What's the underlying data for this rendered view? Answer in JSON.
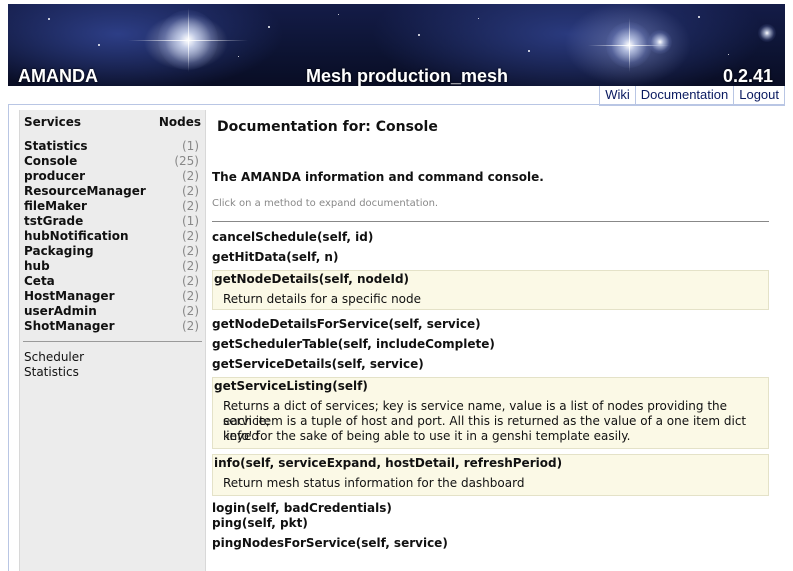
{
  "header": {
    "app_title": "AMANDA",
    "mesh_title": "Mesh production_mesh",
    "version": "0.2.41"
  },
  "nav": {
    "links": [
      "Wiki",
      "Documentation",
      "Logout"
    ]
  },
  "sidebar": {
    "col_services": "Services",
    "col_nodes": "Nodes",
    "services": [
      {
        "name": "Statistics",
        "count": "(1)"
      },
      {
        "name": "Console",
        "count": "(25)"
      },
      {
        "name": "producer",
        "count": "(2)"
      },
      {
        "name": "ResourceManager",
        "count": "(2)"
      },
      {
        "name": "fileMaker",
        "count": "(2)"
      },
      {
        "name": "tstGrade",
        "count": "(1)"
      },
      {
        "name": "hubNotification",
        "count": "(2)"
      },
      {
        "name": "Packaging",
        "count": "(2)"
      },
      {
        "name": "hub",
        "count": "(2)"
      },
      {
        "name": "Ceta",
        "count": "(2)"
      },
      {
        "name": "HostManager",
        "count": "(2)"
      },
      {
        "name": "userAdmin",
        "count": "(2)"
      },
      {
        "name": "ShotManager",
        "count": "(2)"
      }
    ],
    "links": [
      "Scheduler",
      "Statistics"
    ]
  },
  "main": {
    "title": "Documentation for: Console",
    "service_description": "The AMANDA information and command console.",
    "hint": "Click on a method to expand documentation.",
    "methods": [
      {
        "sig": "cancelSchedule(self, id)"
      },
      {
        "sig": "getHitData(self, n)"
      },
      {
        "sig": "getNodeDetails(self, nodeId)",
        "doc": [
          "Return details for a specific node"
        ]
      },
      {
        "sig": "getNodeDetailsForService(self, service)"
      },
      {
        "sig": "getSchedulerTable(self, includeComplete)"
      },
      {
        "sig": "getServiceDetails(self, service)"
      },
      {
        "sig": "getServiceListing(self)",
        "doc": [
          "Returns a dict of services; key is service name, value is a list of nodes providing the service;",
          "each item is a tuple of host and port. All this is returned as the value of a one item dict keyed",
          "'info' for the sake of being able to use it in a genshi template easily."
        ]
      },
      {
        "sig": "info(self, serviceExpand, hostDetail, refreshPeriod)",
        "doc": [
          "Return mesh status information for the dashboard"
        ]
      },
      {
        "sig": "login(self, badCredentials)"
      },
      {
        "sig": "ping(self, pkt)"
      },
      {
        "sig": "pingNodesForService(self, service)"
      }
    ]
  }
}
